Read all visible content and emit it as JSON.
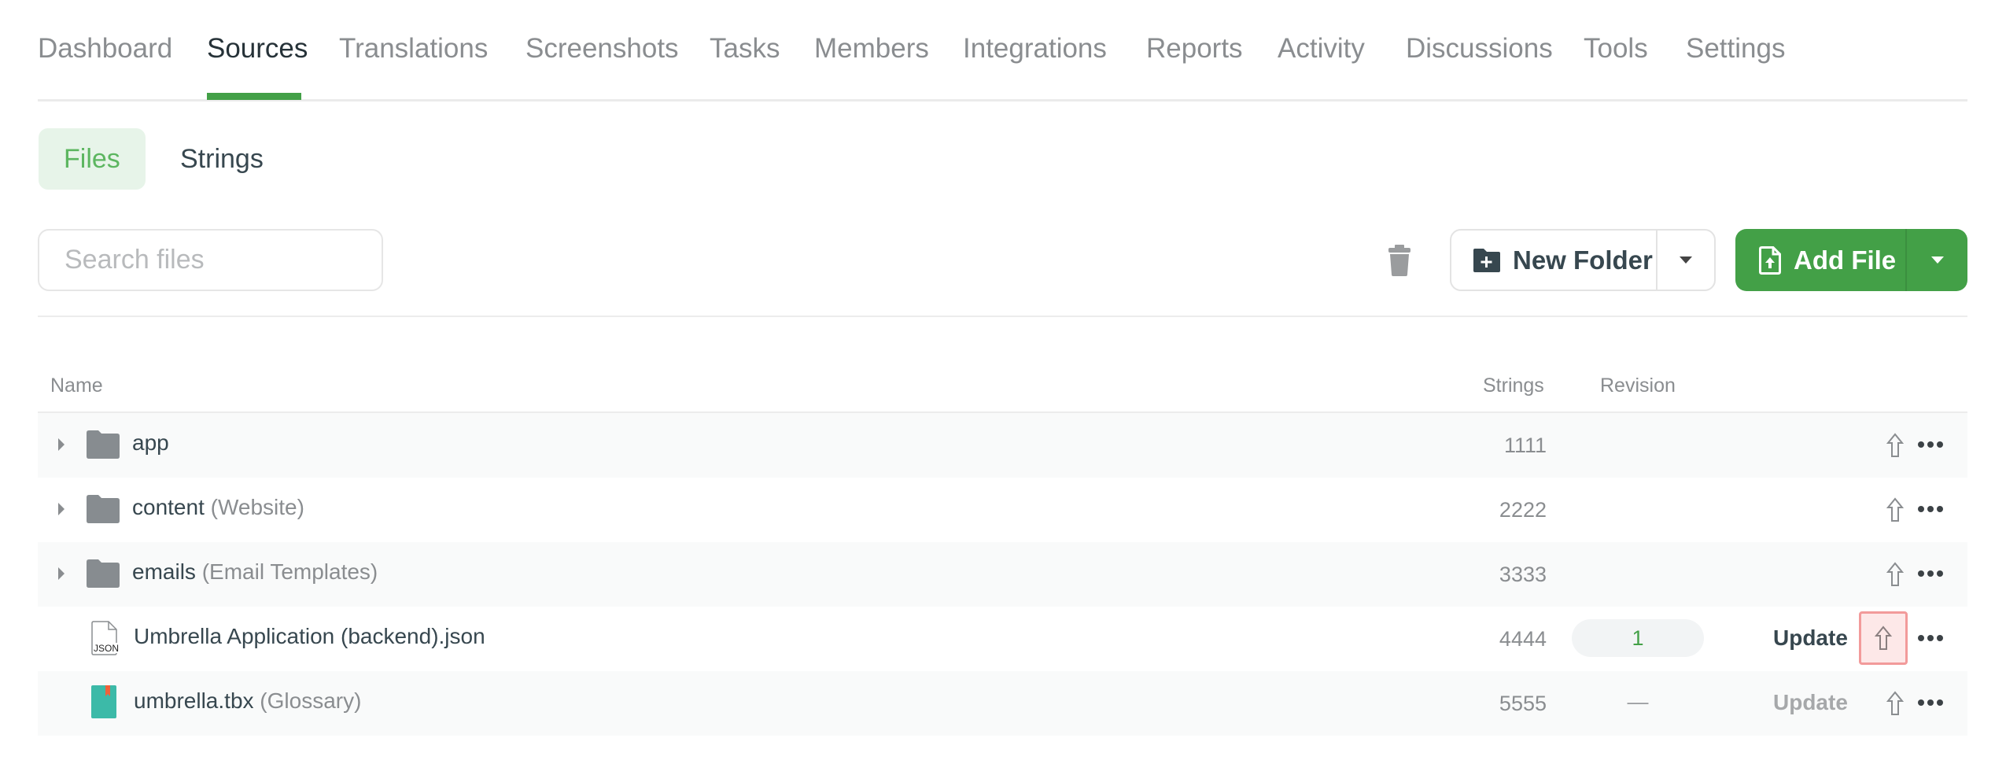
{
  "nav": {
    "tabs": [
      {
        "label": "Dashboard",
        "active": false
      },
      {
        "label": "Sources",
        "active": true
      },
      {
        "label": "Translations",
        "active": false
      },
      {
        "label": "Screenshots",
        "active": false
      },
      {
        "label": "Tasks",
        "active": false
      },
      {
        "label": "Members",
        "active": false
      },
      {
        "label": "Integrations",
        "active": false
      },
      {
        "label": "Reports",
        "active": false
      },
      {
        "label": "Activity",
        "active": false
      },
      {
        "label": "Discussions",
        "active": false
      },
      {
        "label": "Tools",
        "active": false
      },
      {
        "label": "Settings",
        "active": false
      }
    ]
  },
  "subtabs": {
    "files": "Files",
    "strings": "Strings",
    "active": "Files"
  },
  "toolbar": {
    "search_placeholder": "Search files",
    "search_value": "",
    "delete_icon": "trash-icon",
    "new_folder_label": "New Folder",
    "new_folder_icon": "folder-plus-icon",
    "add_file_label": "Add File",
    "add_file_icon": "file-upload-icon",
    "dropdown_icon": "caret-down-icon"
  },
  "colors": {
    "accent": "#43a047",
    "accent_light": "#e7f4e9",
    "highlight_border": "#f29a9a",
    "highlight_bg": "#fde8e8",
    "glossary_icon": "#3cbaa8",
    "glossary_bookmark": "#f0613a"
  },
  "table": {
    "headers": {
      "name": "Name",
      "strings": "Strings",
      "revision": "Revision"
    },
    "rows": [
      {
        "type": "folder",
        "name": "app",
        "title": "",
        "strings": "1111",
        "revision": "",
        "update": "",
        "upload_highlighted": false
      },
      {
        "type": "folder",
        "name": "content",
        "title": "(Website)",
        "strings": "2222",
        "revision": "",
        "update": "",
        "upload_highlighted": false
      },
      {
        "type": "folder",
        "name": "emails",
        "title": "(Email Templates)",
        "strings": "3333",
        "revision": "",
        "update": "",
        "upload_highlighted": false
      },
      {
        "type": "json-file",
        "name": "Umbrella Application (backend).json",
        "title": "",
        "strings": "4444",
        "revision": "1",
        "update": "Update",
        "update_enabled": true,
        "upload_highlighted": true
      },
      {
        "type": "glossary-file",
        "name": "umbrella.tbx",
        "title": "(Glossary)",
        "strings": "5555",
        "revision": "—",
        "update": "Update",
        "update_enabled": false,
        "upload_highlighted": false
      }
    ]
  }
}
